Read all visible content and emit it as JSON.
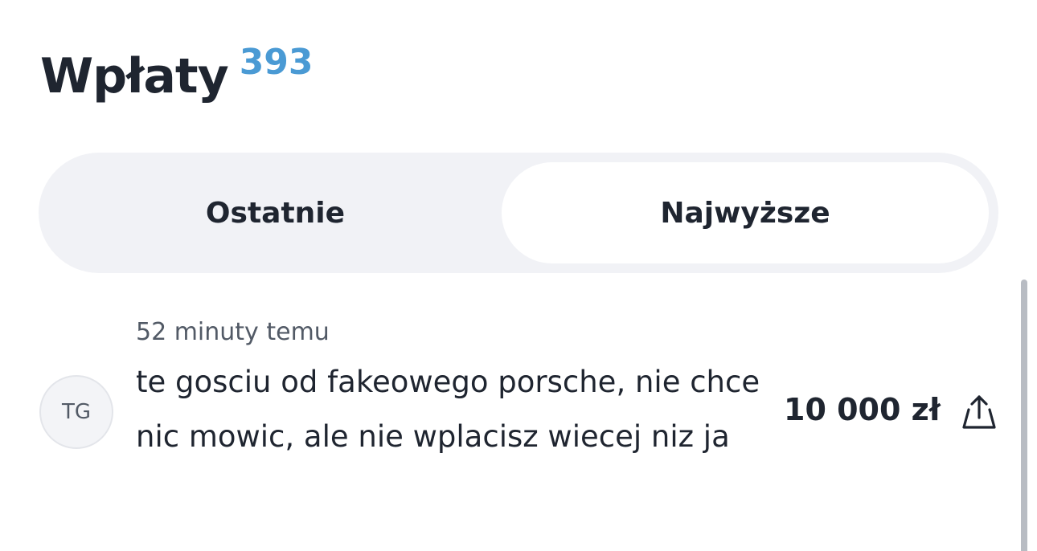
{
  "header": {
    "title": "Wpłaty",
    "count": "393"
  },
  "tabs": [
    {
      "label": "Ostatnie",
      "selected": false
    },
    {
      "label": "Najwyższe",
      "selected": true
    }
  ],
  "donations": [
    {
      "avatar_initials": "TG",
      "time": "52 minuty temu",
      "message": "te gosciu od fakeowego porsche, nie chce nic mowic, ale nie wplacisz wiecej niz ja",
      "amount": "10 000 zł",
      "share_icon": "share-icon"
    }
  ]
}
